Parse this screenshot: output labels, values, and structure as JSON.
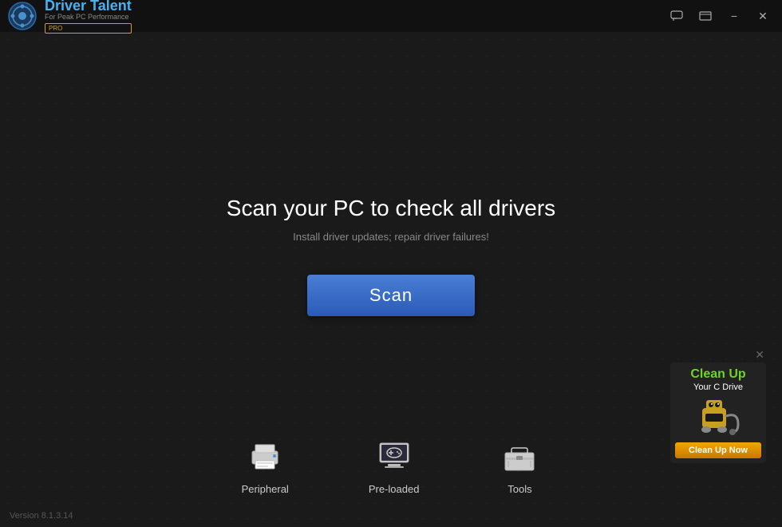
{
  "app": {
    "title": "Driver Talent",
    "subtitle": "For Peak PC Performance",
    "pro_label": "PRO",
    "version": "Version 8.1.3.14"
  },
  "titlebar": {
    "chat_icon": "chat-icon",
    "menu_icon": "menu-icon",
    "minimize_label": "−",
    "close_label": "✕"
  },
  "main": {
    "heading": "Scan your PC to check all drivers",
    "subheading": "Install driver updates; repair driver failures!",
    "scan_button_label": "Scan"
  },
  "bottom_icons": [
    {
      "id": "peripheral",
      "label": "Peripheral"
    },
    {
      "id": "preloaded",
      "label": "Pre-loaded"
    },
    {
      "id": "tools",
      "label": "Tools"
    }
  ],
  "cleanup": {
    "title_green": "Clean Up",
    "title_white": "Your C Drive",
    "button_label": "Clean Up Now"
  }
}
